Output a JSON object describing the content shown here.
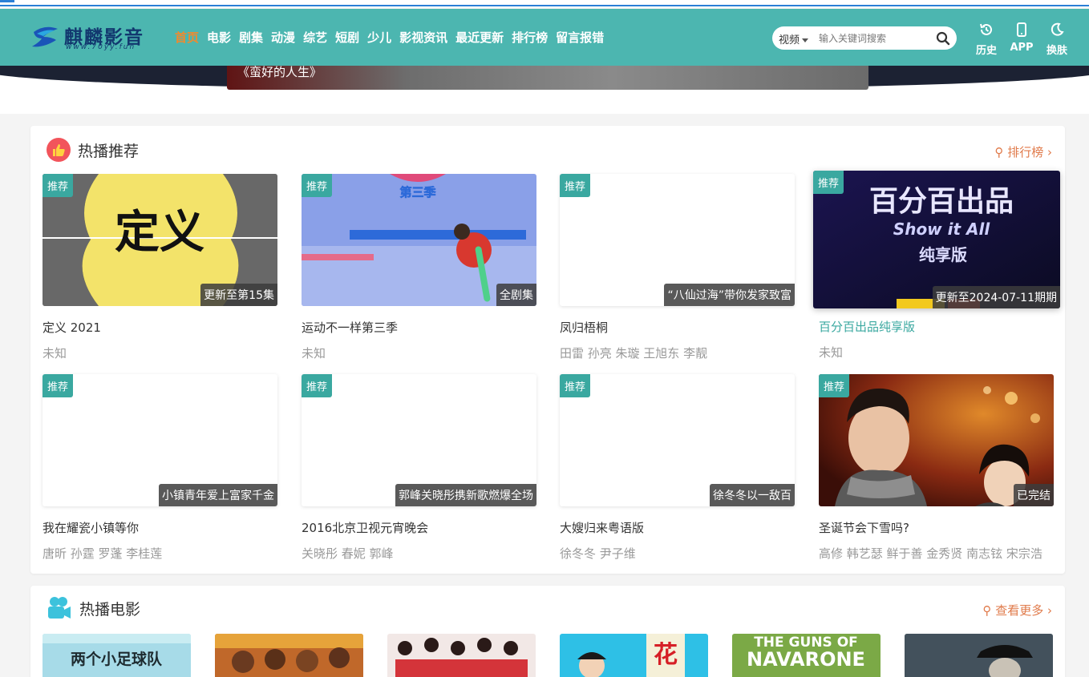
{
  "site": {
    "name": "麒麟影音",
    "url": "www.70yy.fun"
  },
  "nav": [
    "首页",
    "电影",
    "剧集",
    "动漫",
    "综艺",
    "短剧",
    "少儿",
    "影视资讯",
    "最近更新",
    "排行榜",
    "留言报错"
  ],
  "search": {
    "type": "视频",
    "placeholder": "输入关键词搜索"
  },
  "tools": {
    "history": "历史",
    "app": "APP",
    "theme": "换肤"
  },
  "banner": {
    "caption": "《蛮好的人生》"
  },
  "hot": {
    "title": "热播推荐",
    "more": "排行榜",
    "badge": "推荐",
    "items": [
      {
        "title": "定义 2021",
        "sub": "未知",
        "status": "更新至第15集"
      },
      {
        "title": "运动不一样第三季",
        "sub": "未知",
        "status": "全剧集"
      },
      {
        "title": "凤归梧桐",
        "sub": "田雷 孙亮 朱璇 王旭东 李靓",
        "status": "“八仙过海”带你发家致富"
      },
      {
        "title": "百分百出品纯享版",
        "sub": "未知",
        "status": "更新至2024-07-11期期"
      },
      {
        "title": "我在耀瓷小镇等你",
        "sub": "唐昕 孙霆 罗蓬 李桂莲",
        "status": "小镇青年爱上富家千金"
      },
      {
        "title": "2016北京卫视元宵晚会",
        "sub": "关晓彤 春妮 郭峰",
        "status": "郭峰关晓彤携新歌燃爆全场"
      },
      {
        "title": "大嫂归来粤语版",
        "sub": "徐冬冬 尹子维",
        "status": "徐冬冬以一敌百"
      },
      {
        "title": "圣诞节会下雪吗?",
        "sub": "高修 韩艺瑟 鲜于善 金秀贤 南志铉 宋宗浩",
        "status": "已完结"
      }
    ],
    "thumb_text": {
      "dingyi": "定义",
      "season": "第三季",
      "baifen": "百分百出品",
      "baifen_en": "Show it All",
      "baifen_sub": "纯享版"
    }
  },
  "movies": {
    "title": "热播电影",
    "more": "查看更多",
    "thumb_text": {
      "football": "两个小足球队",
      "hua": "花",
      "guns1": "THE GUNS OF",
      "guns2": "NAVARONE"
    }
  },
  "colors": {
    "header": "#4cb6b0",
    "accent": "#3aa8a0",
    "nav_active": "#f08a2e",
    "more_link": "#e07a4a"
  }
}
